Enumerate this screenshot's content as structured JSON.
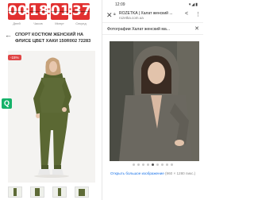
{
  "left": {
    "timer": {
      "days": "00",
      "hours": "18",
      "minutes": "01",
      "seconds": "37",
      "labels": [
        "Дней",
        "Часов",
        "Минут",
        "Секунд"
      ]
    },
    "product_title": "СПОРТ КОСТЮМ ЖЕНСКИЙ НА ФЛИСЕ ЦВЕТ ХАКИ 150R002 72283",
    "badge": "-15%",
    "q_button": "Q",
    "thumbnail_count": 4
  },
  "right": {
    "status": {
      "time": "12:09",
      "icons": "▾◢▮"
    },
    "urlbar": {
      "title": "ROZETKA | Халат женский ...",
      "url": "rozetka.com.ua"
    },
    "panel_title": "Фотографии Халат женский ма...",
    "gallery": {
      "total": 9,
      "active_index": 4
    },
    "open_bigger_link": "Открыть большое изображение",
    "image_size": "(960 × 1280 пикс.)"
  },
  "colors": {
    "timer_red": "#e23131",
    "khaki": "#5e6b37",
    "q_green": "#16b26a",
    "link_blue": "#1a73e8",
    "robe_gray": "#6b6860"
  }
}
